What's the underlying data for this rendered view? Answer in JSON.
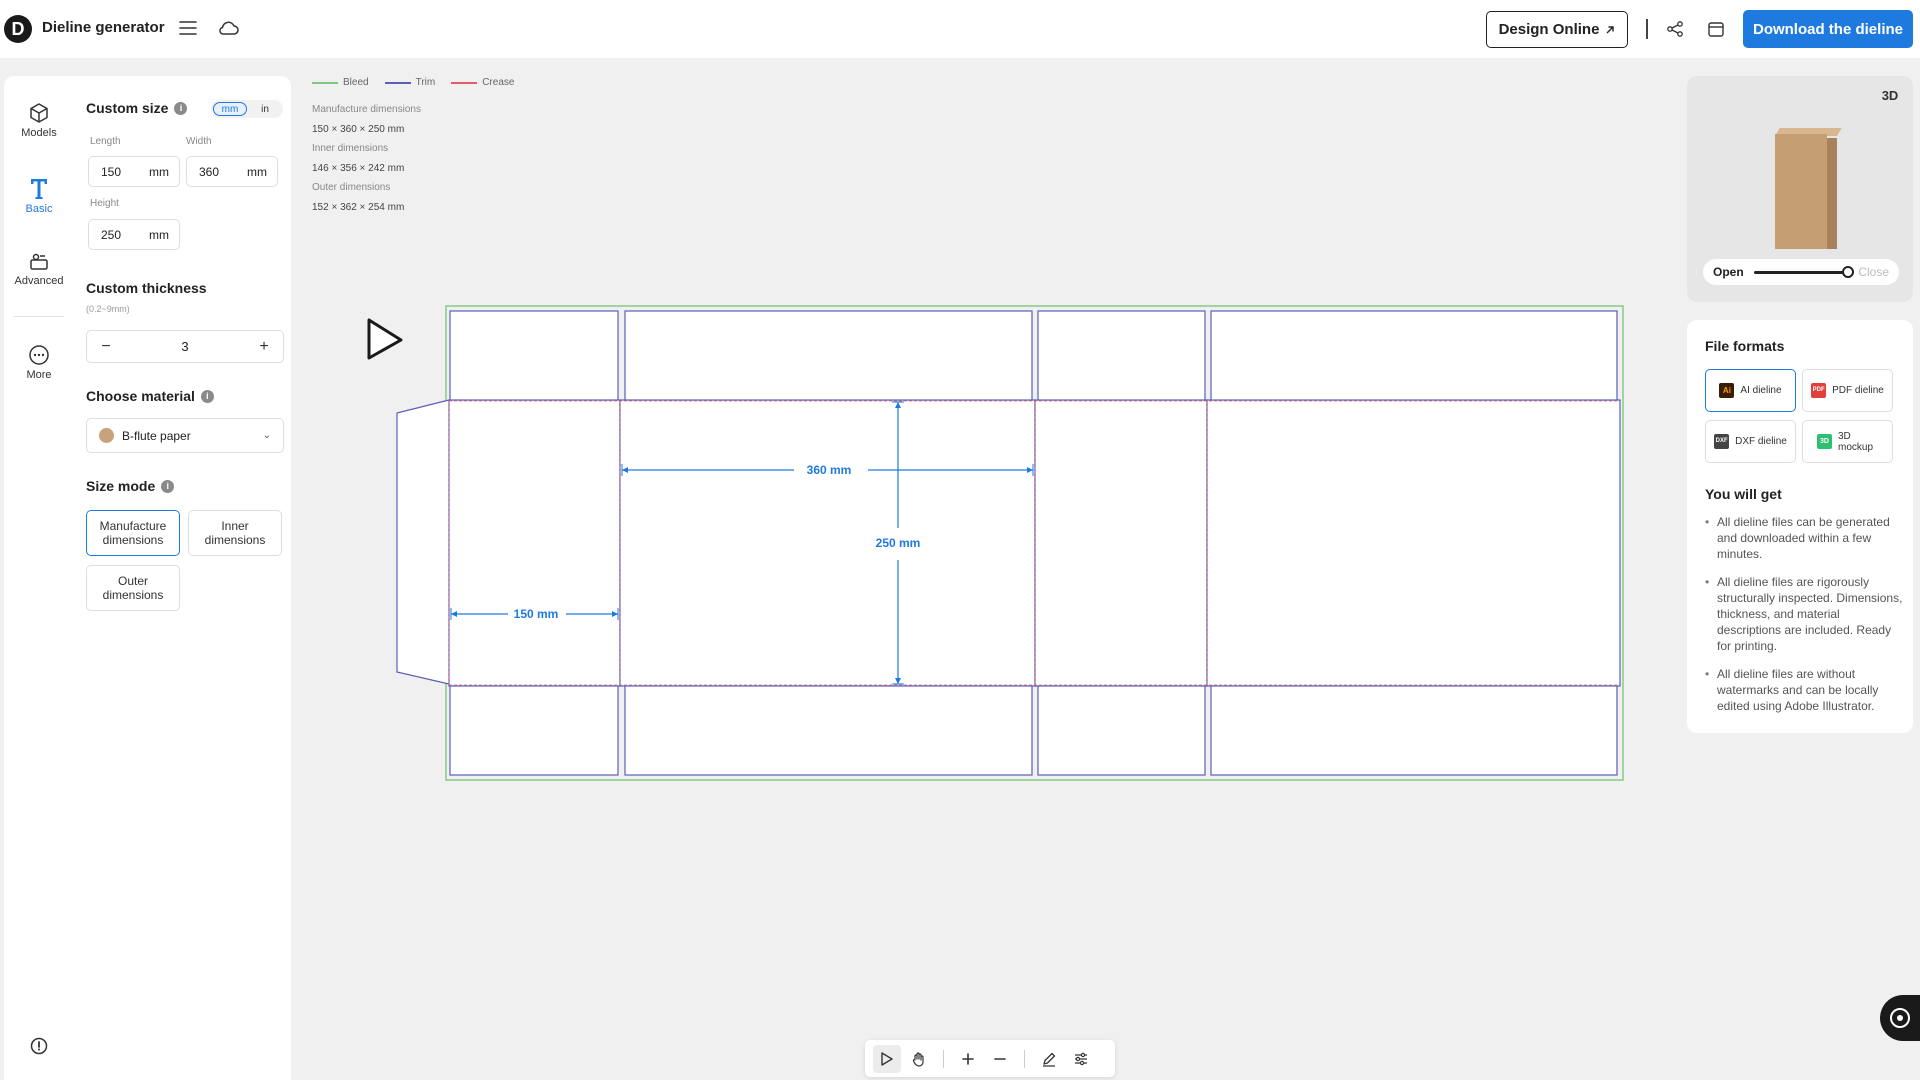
{
  "app": {
    "title": "Dieline generator",
    "logo_letter": "D"
  },
  "header": {
    "design_online_label": "Design Online",
    "download_label": "Download the dieline",
    "icons": [
      "menu-icon",
      "cloud-icon",
      "share-icon",
      "save-icon"
    ]
  },
  "nav": {
    "items": [
      {
        "label": "Models",
        "icon": "cube-icon"
      },
      {
        "label": "Basic",
        "icon": "text-t-icon",
        "active": true
      },
      {
        "label": "Advanced",
        "icon": "advanced-icon"
      },
      {
        "label": "More",
        "icon": "more-dots-icon"
      }
    ]
  },
  "custom_size": {
    "title": "Custom size",
    "units": [
      "mm",
      "in"
    ],
    "active_unit": "mm",
    "length": {
      "label": "Length",
      "value": "150",
      "unit": "mm"
    },
    "width": {
      "label": "Width",
      "value": "360",
      "unit": "mm"
    },
    "height": {
      "label": "Height",
      "value": "250",
      "unit": "mm"
    }
  },
  "thickness": {
    "title": "Custom thickness",
    "range": "(0.2~9mm)",
    "value": "3",
    "minus": "−",
    "plus": "+"
  },
  "material": {
    "title": "Choose material",
    "selected": "B-flute paper",
    "swatch_color": "#c7a27a"
  },
  "size_mode": {
    "title": "Size mode",
    "options": [
      "Manufacture dimensions",
      "Inner dimensions",
      "Outer dimensions"
    ],
    "active": "Manufacture dimensions"
  },
  "legend": [
    {
      "label": "Bleed",
      "color": "#7ec77e"
    },
    {
      "label": "Trim",
      "color": "#5b5fb8"
    },
    {
      "label": "Crease",
      "color": "#e05a6a"
    }
  ],
  "dimensions_info": {
    "manufacture_label": "Manufacture dimensions",
    "manufacture_value": "150 × 360 × 250 mm",
    "inner_label": "Inner dimensions",
    "inner_value": "146 × 356 × 242 mm",
    "outer_label": "Outer dimensions",
    "outer_value": "152 × 362 × 254 mm"
  },
  "dieline": {
    "length_label": "360 mm",
    "height_label": "250 mm",
    "width_label": "150 mm",
    "dimension_color": "#1f7ae0"
  },
  "preview": {
    "badge": "3D",
    "open_label": "Open",
    "close_label": "Close",
    "open_level": 1.0
  },
  "file_formats": {
    "title": "File formats",
    "options": [
      {
        "label": "AI dieline",
        "icon": "ai-icon",
        "icon_text": "Ai",
        "color": "#3b1d06"
      },
      {
        "label": "PDF dieline",
        "icon": "pdf-icon",
        "icon_text": "PDF",
        "color": "#e0403a"
      },
      {
        "label": "DXF dieline",
        "icon": "dxf-icon",
        "icon_text": "DXF",
        "color": "#444444"
      },
      {
        "label": "3D mockup",
        "icon": "mockup-icon",
        "icon_text": "3D",
        "color": "#2fbf71"
      }
    ],
    "active": "AI dieline"
  },
  "you_will_get": {
    "title": "You will get",
    "items": [
      "All dieline files can be generated and downloaded within a few minutes.",
      "All dieline files are rigorously structurally inspected. Dimensions, thickness, and material descriptions are included. Ready for printing.",
      "All dieline files are without watermarks and can be locally edited using Adobe Illustrator."
    ]
  },
  "toolbar": {
    "tools": [
      "select-icon",
      "hand-icon",
      "zoom-in-icon",
      "zoom-out-icon",
      "pen-icon",
      "settings-sliders-icon"
    ]
  },
  "colors": {
    "accent": "#1f7ae0",
    "bleed": "#7ec77e",
    "trim": "#5b5fb8",
    "crease": "#e05a6a"
  }
}
